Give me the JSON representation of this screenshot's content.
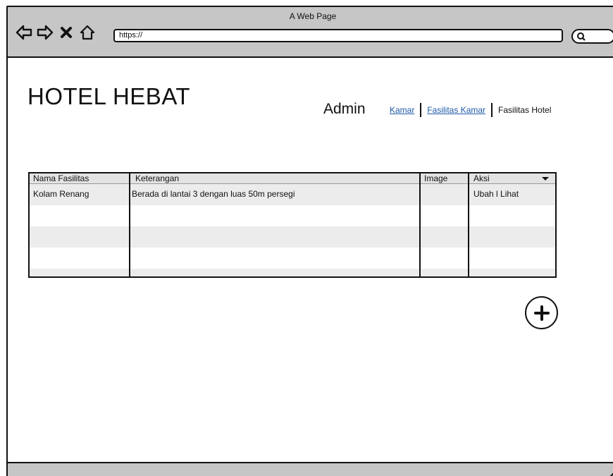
{
  "browser": {
    "title": "A Web Page",
    "url": "https://",
    "icons": [
      "back-icon",
      "forward-icon",
      "close-icon",
      "home-icon",
      "search-icon"
    ]
  },
  "header": {
    "title": "HOTEL HEBAT",
    "role": "Admin",
    "nav": [
      {
        "label": "Kamar",
        "link": true
      },
      {
        "label": "Fasilitas Kamar",
        "link": true
      },
      {
        "label": "Fasilitas Hotel",
        "link": false
      }
    ]
  },
  "table": {
    "columns": [
      "Nama Fasilitas",
      "Keterangan",
      "Image",
      "Aksi"
    ],
    "rows": [
      {
        "nama": "Kolam Renang",
        "keterangan": "Berada di lantai 3 dengan luas 50m persegi",
        "image": "",
        "aksi": "Ubah l Lihat"
      }
    ]
  },
  "colors": {
    "chrome": "#c6c6c6",
    "link": "#1f5aa8",
    "row_shade": "#ececec"
  },
  "add_button": {
    "icon": "plus-circle-icon"
  }
}
